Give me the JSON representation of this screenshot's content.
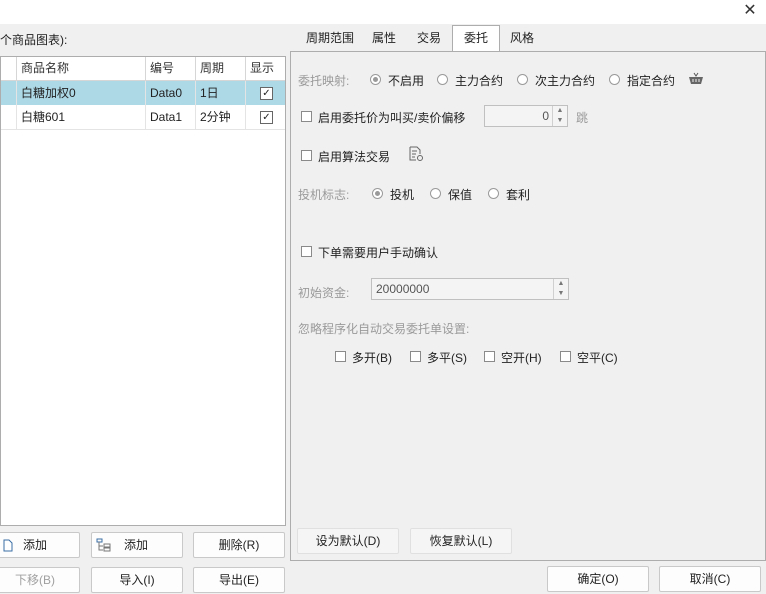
{
  "window": {
    "close_glyph": "✕"
  },
  "left": {
    "caption": "个商品图表):",
    "columns": [
      "商品名称",
      "编号",
      "周期",
      "显示"
    ],
    "rows": [
      {
        "name": "白糖加权0",
        "code": "Data0",
        "period": "1日",
        "show": "✓"
      },
      {
        "name": "白糖601",
        "code": "Data1",
        "period": "2分钟",
        "show": "✓"
      }
    ],
    "buttons": {
      "add1": "添加",
      "add2": "添加",
      "delete": "删除(R)",
      "move_down": "下移(B)",
      "import": "导入(I)",
      "export": "导出(E)"
    }
  },
  "tabs": [
    "周期范围",
    "属性",
    "交易",
    "委托",
    "风格"
  ],
  "active_tab": "委托",
  "order": {
    "mapping_label": "委托映射:",
    "mapping_options": [
      "不启用",
      "主力合约",
      "次主力合约",
      "指定合约"
    ],
    "enable_price_offset": "启用委托价为叫买/卖价偏移",
    "offset_value": "0",
    "offset_unit": "跳",
    "enable_algo": "启用算法交易",
    "spec_label": "投机标志:",
    "spec_options": [
      "投机",
      "保值",
      "套利"
    ],
    "manual_confirm": "下单需要用户手动确认",
    "capital_label": "初始资金:",
    "capital_value": "20000000",
    "ignore_label": "忽略程序化自动交易委托单设置:",
    "ignore_options": [
      "多开(B)",
      "多平(S)",
      "空开(H)",
      "空平(C)"
    ],
    "set_default": "设为默认(D)",
    "restore_default": "恢复默认(L)"
  },
  "footer": {
    "ok": "确定(O)",
    "cancel": "取消(C)"
  }
}
